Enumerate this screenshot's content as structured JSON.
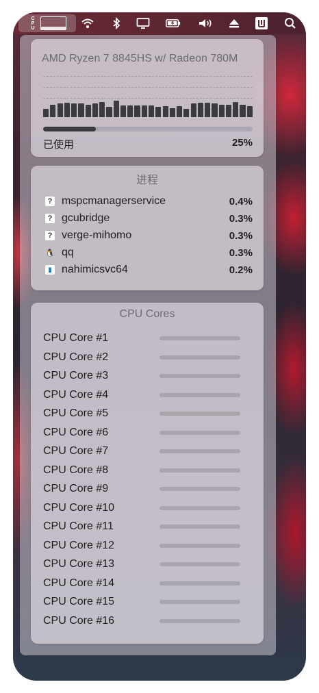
{
  "menubar": {
    "cpu_label": [
      "C",
      "P",
      "U"
    ],
    "cpu_graph_level": 0.25,
    "icons": [
      "wifi-icon",
      "bluetooth-icon",
      "display-icon",
      "battery-icon",
      "volume-icon",
      "eject-icon",
      "keyboard-icon",
      "search-icon"
    ]
  },
  "cpu_card": {
    "model": "AMD Ryzen 7 8845HS w/ Radeon 780M",
    "history": [
      0.18,
      0.28,
      0.3,
      0.32,
      0.3,
      0.3,
      0.28,
      0.3,
      0.34,
      0.22,
      0.36,
      0.26,
      0.26,
      0.26,
      0.26,
      0.26,
      0.22,
      0.24,
      0.2,
      0.24,
      0.18,
      0.3,
      0.32,
      0.32,
      0.3,
      0.28,
      0.28,
      0.34,
      0.28,
      0.24
    ],
    "usage_label": "已使用",
    "usage_value": "25%",
    "usage_fraction": 0.25
  },
  "process_card": {
    "title": "进程",
    "processes": [
      {
        "name": "mspcmanagerservice",
        "value": "0.4%",
        "icon": "unknown-app-icon",
        "glyph": "?"
      },
      {
        "name": "gcubridge",
        "value": "0.3%",
        "icon": "unknown-app-icon",
        "glyph": "?"
      },
      {
        "name": "verge-mihomo",
        "value": "0.3%",
        "icon": "unknown-app-icon",
        "glyph": "?"
      },
      {
        "name": "qq",
        "value": "0.3%",
        "icon": "qq-penguin-icon",
        "glyph": "🐧"
      },
      {
        "name": "nahimicsvc64",
        "value": "0.2%",
        "icon": "nahimic-app-icon",
        "glyph": "▮"
      }
    ]
  },
  "cores_card": {
    "title": "CPU Cores",
    "cores": [
      {
        "label": "CPU Core #1",
        "level": 0
      },
      {
        "label": "CPU Core #2",
        "level": 0
      },
      {
        "label": "CPU Core #3",
        "level": 0
      },
      {
        "label": "CPU Core #4",
        "level": 0
      },
      {
        "label": "CPU Core #5",
        "level": 0
      },
      {
        "label": "CPU Core #6",
        "level": 0
      },
      {
        "label": "CPU Core #7",
        "level": 0
      },
      {
        "label": "CPU Core #8",
        "level": 0
      },
      {
        "label": "CPU Core #9",
        "level": 0
      },
      {
        "label": "CPU Core #10",
        "level": 0
      },
      {
        "label": "CPU Core #11",
        "level": 0
      },
      {
        "label": "CPU Core #12",
        "level": 0
      },
      {
        "label": "CPU Core #13",
        "level": 0
      },
      {
        "label": "CPU Core #14",
        "level": 0
      },
      {
        "label": "CPU Core #15",
        "level": 0
      },
      {
        "label": "CPU Core #16",
        "level": 0
      }
    ]
  }
}
